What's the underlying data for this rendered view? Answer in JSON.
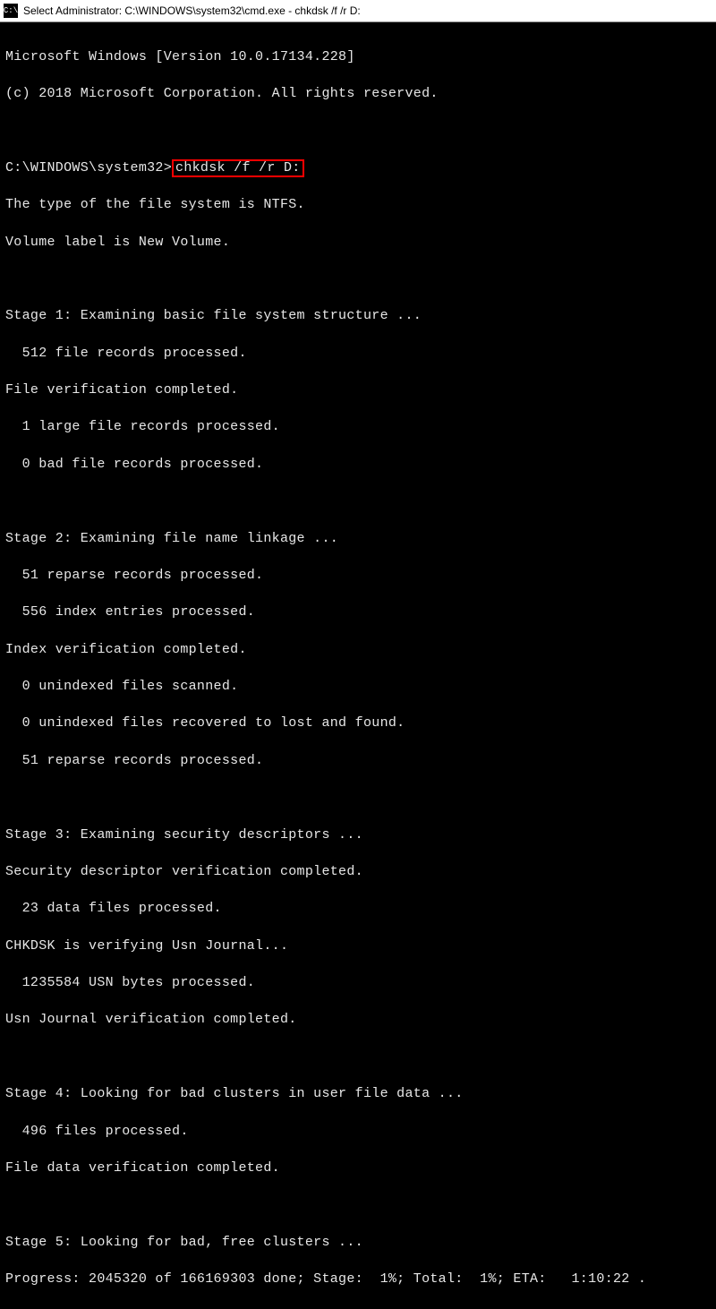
{
  "titlebar": {
    "icon_text": "C:\\",
    "title": "Select Administrator: C:\\WINDOWS\\system32\\cmd.exe - chkdsk /f /r D:"
  },
  "terminal": {
    "header1": "Microsoft Windows [Version 10.0.17134.228]",
    "header2": "(c) 2018 Microsoft Corporation. All rights reserved.",
    "prompt_path": "C:\\WINDOWS\\system32>",
    "command": "chkdsk /f /r D:",
    "fs_type": "The type of the file system is NTFS.",
    "volume_label": "Volume label is New Volume.",
    "stage1_title": "Stage 1: Examining basic file system structure ...",
    "stage1_l1": "  512 file records processed.",
    "stage1_l2": "File verification completed.",
    "stage1_l3": "  1 large file records processed.",
    "stage1_l4": "  0 bad file records processed.",
    "stage2_title": "Stage 2: Examining file name linkage ...",
    "stage2_l1": "  51 reparse records processed.",
    "stage2_l2": "  556 index entries processed.",
    "stage2_l3": "Index verification completed.",
    "stage2_l4": "  0 unindexed files scanned.",
    "stage2_l5": "  0 unindexed files recovered to lost and found.",
    "stage2_l6": "  51 reparse records processed.",
    "stage3_title": "Stage 3: Examining security descriptors ...",
    "stage3_l1": "Security descriptor verification completed.",
    "stage3_l2": "  23 data files processed.",
    "stage3_l3": "CHKDSK is verifying Usn Journal...",
    "stage3_l4": "  1235584 USN bytes processed.",
    "stage3_l5": "Usn Journal verification completed.",
    "stage4_title": "Stage 4: Looking for bad clusters in user file data ...",
    "stage4_l1": "  496 files processed.",
    "stage4_l2": "File data verification completed.",
    "stage5_title": "Stage 5: Looking for bad, free clusters ...",
    "progress": "Progress: 2045320 of 166169303 done; Stage:  1%; Total:  1%; ETA:   1:10:22 ."
  }
}
